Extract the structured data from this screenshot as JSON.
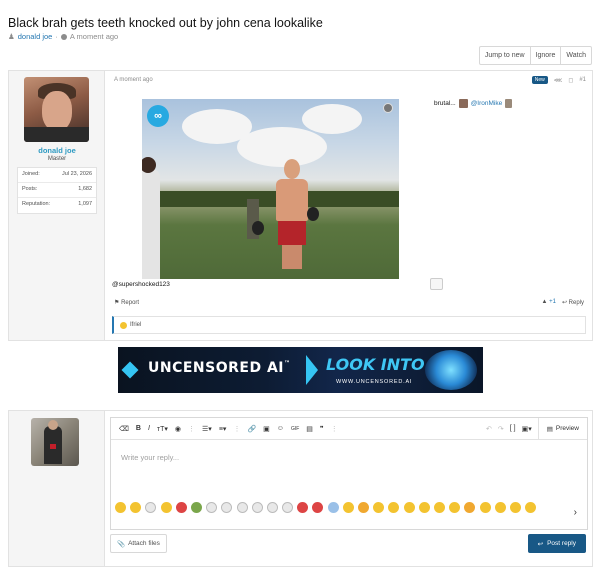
{
  "thread": {
    "title": "Black brah gets teeth knocked out by john cena lookalike",
    "author": "donald joe",
    "time": "A moment ago"
  },
  "thread_buttons": [
    "Jump to new",
    "Ignore",
    "Watch"
  ],
  "post": {
    "time": "A moment ago",
    "badge": "New",
    "number": "#1",
    "user": {
      "name": "donald joe",
      "title": "Master",
      "stats": [
        {
          "label": "Joined:",
          "value": "Jul 23, 2026"
        },
        {
          "label": "Posts:",
          "value": "1,682"
        },
        {
          "label": "Reputation:",
          "value": "1,097"
        }
      ]
    },
    "caption_prefix": "brutal...",
    "mention": "@IronMike",
    "source": "@supershocked123",
    "report_label": "Report",
    "likes": "+1",
    "reply_label": "Reply",
    "reaction_user": "Ifriel"
  },
  "banner": {
    "brand": "UNCENSORED AI",
    "tm": "™",
    "cta": "LOOK INTO IT",
    "url": "WWW.UNCENSORED.AI"
  },
  "editor": {
    "placeholder": "Write your reply...",
    "preview_label": "Preview",
    "attach_label": "Attach files",
    "post_reply_label": "Post reply",
    "toolbar_icons": [
      "eraser-icon",
      "bold-icon",
      "italic-icon",
      "text-size-icon",
      "color-icon",
      "more-icon",
      "list-icon",
      "align-icon",
      "link-icon",
      "image-icon",
      "emoji-icon",
      "gif-icon",
      "media-icon",
      "quote-icon",
      "more-icon"
    ]
  },
  "colors": {
    "accent": "#185886",
    "link": "#2577b1",
    "username": "#2e9ac2"
  }
}
